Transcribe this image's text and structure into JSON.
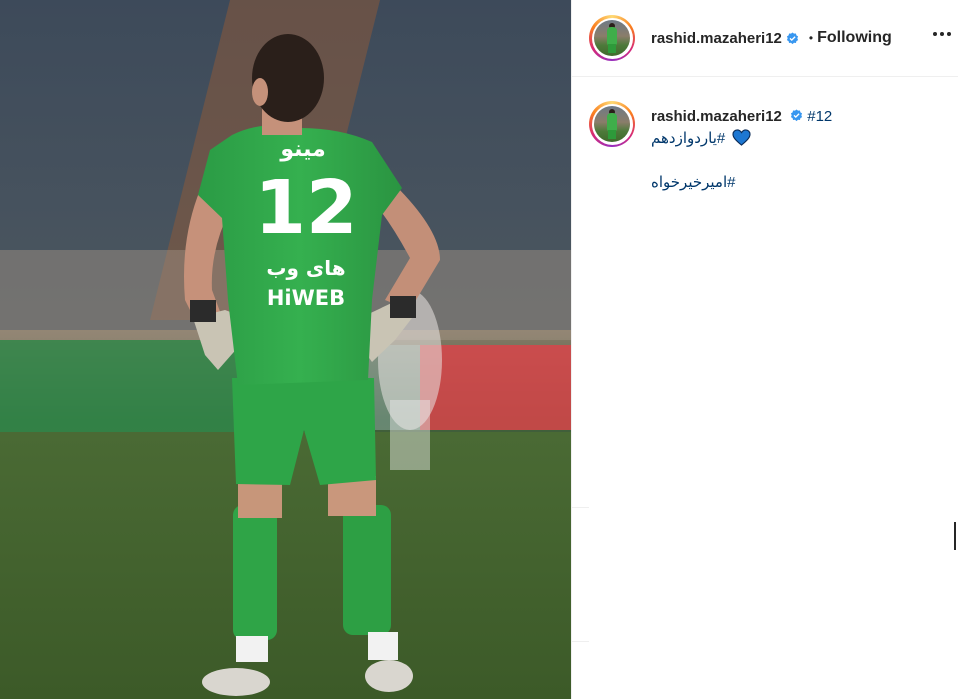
{
  "post": {
    "media": {
      "description_icon": "goalkeeper-photo",
      "jersey_number": "12",
      "sponsor_top": "مینو",
      "sponsor_bottom_fa": "های وب",
      "sponsor_bottom_en": "HiWEB"
    },
    "header": {
      "username": "rashid.mazaheri12",
      "verified_icon": "verified-badge-icon",
      "separator": "•",
      "follow_status": "Following",
      "more_icon": "more-options-icon"
    },
    "caption": {
      "username": "rashid.mazaheri12",
      "hashtag_1": "#12",
      "hashtag_2": "#یاردوازدهم",
      "heart_icon": "blue-heart-icon",
      "hashtag_3": "#امیرخیرخواه"
    },
    "colors": {
      "accent_link": "#00376b",
      "verified_blue": "#3897f0",
      "heart_blue": "#1d77d2",
      "jersey_green": "#2fa24a"
    }
  }
}
